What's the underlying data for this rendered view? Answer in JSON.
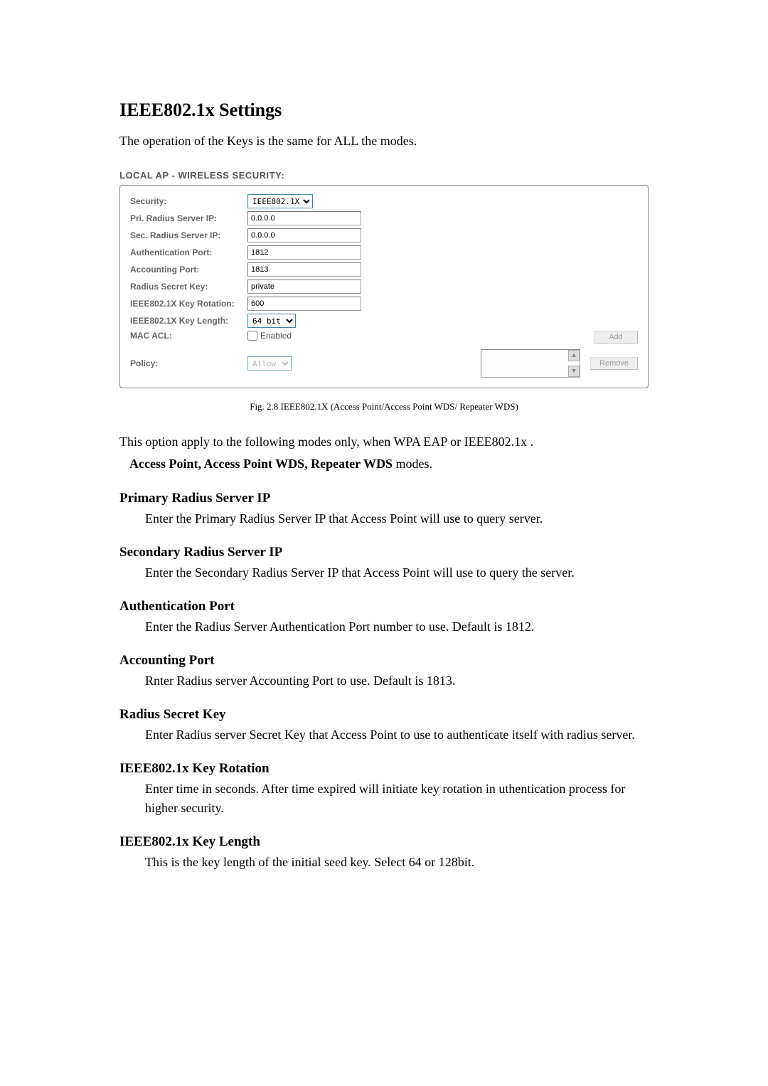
{
  "title": "IEEE802.1x Settings",
  "intro": "The operation of the Keys is the same for ALL the modes.",
  "panel": {
    "header": "LOCAL AP - WIRELESS SECURITY:",
    "rows": {
      "security": {
        "label": "Security:",
        "value": "IEEE802.1X"
      },
      "pri_radius": {
        "label": "Pri. Radius Server IP:",
        "value": "0.0.0.0"
      },
      "sec_radius": {
        "label": "Sec. Radius Server IP:",
        "value": "0.0.0.0"
      },
      "auth_port": {
        "label": "Authentication Port:",
        "value": "1812"
      },
      "acct_port": {
        "label": "Accounting Port:",
        "value": "1813"
      },
      "secret_key": {
        "label": "Radius Secret Key:",
        "value": "private"
      },
      "key_rotation": {
        "label": "IEEE802.1X Key Rotation:",
        "value": "600"
      },
      "key_length": {
        "label": "IEEE802.1X Key Length:",
        "value": "64 bit"
      },
      "mac_acl": {
        "label": "MAC ACL:",
        "checkbox_label": "Enabled"
      },
      "policy": {
        "label": "Policy:",
        "value": "Allow"
      }
    },
    "buttons": {
      "add": "Add",
      "remove": "Remove"
    }
  },
  "figure_caption": "Fig. 2.8 IEEE802.1X (Access Point/Access Point WDS/ Repeater WDS)",
  "option_text": {
    "line1": "This option apply to the following modes only, when WPA EAP or IEEE802.1x .",
    "line2_bold": "Access Point, Access Point WDS, Repeater WDS",
    "line2_tail": " modes."
  },
  "sections": [
    {
      "heading": "Primary Radius Server IP",
      "desc": "Enter the Primary Radius Server IP that Access Point will use to query server."
    },
    {
      "heading": "Secondary Radius Server IP",
      "desc": "Enter the Secondary Radius Server IP that Access Point will use to query the server."
    },
    {
      "heading": "Authentication Port",
      "desc": "Enter the Radius Server Authentication Port number to use. Default is 1812."
    },
    {
      "heading": "Accounting Port",
      "desc": "Rnter Radius server Accounting Port to use. Default is 1813."
    },
    {
      "heading": "Radius Secret Key",
      "desc": "Enter Radius server Secret Key that Access Point to use to authenticate itself with radius server."
    },
    {
      "heading": "IEEE802.1x Key Rotation",
      "desc": "Enter time in seconds. After time expired will initiate key rotation in uthentication process for higher security."
    },
    {
      "heading": "IEEE802.1x Key Length",
      "desc": "This is the key length of the initial seed key. Select 64 or 128bit."
    }
  ]
}
